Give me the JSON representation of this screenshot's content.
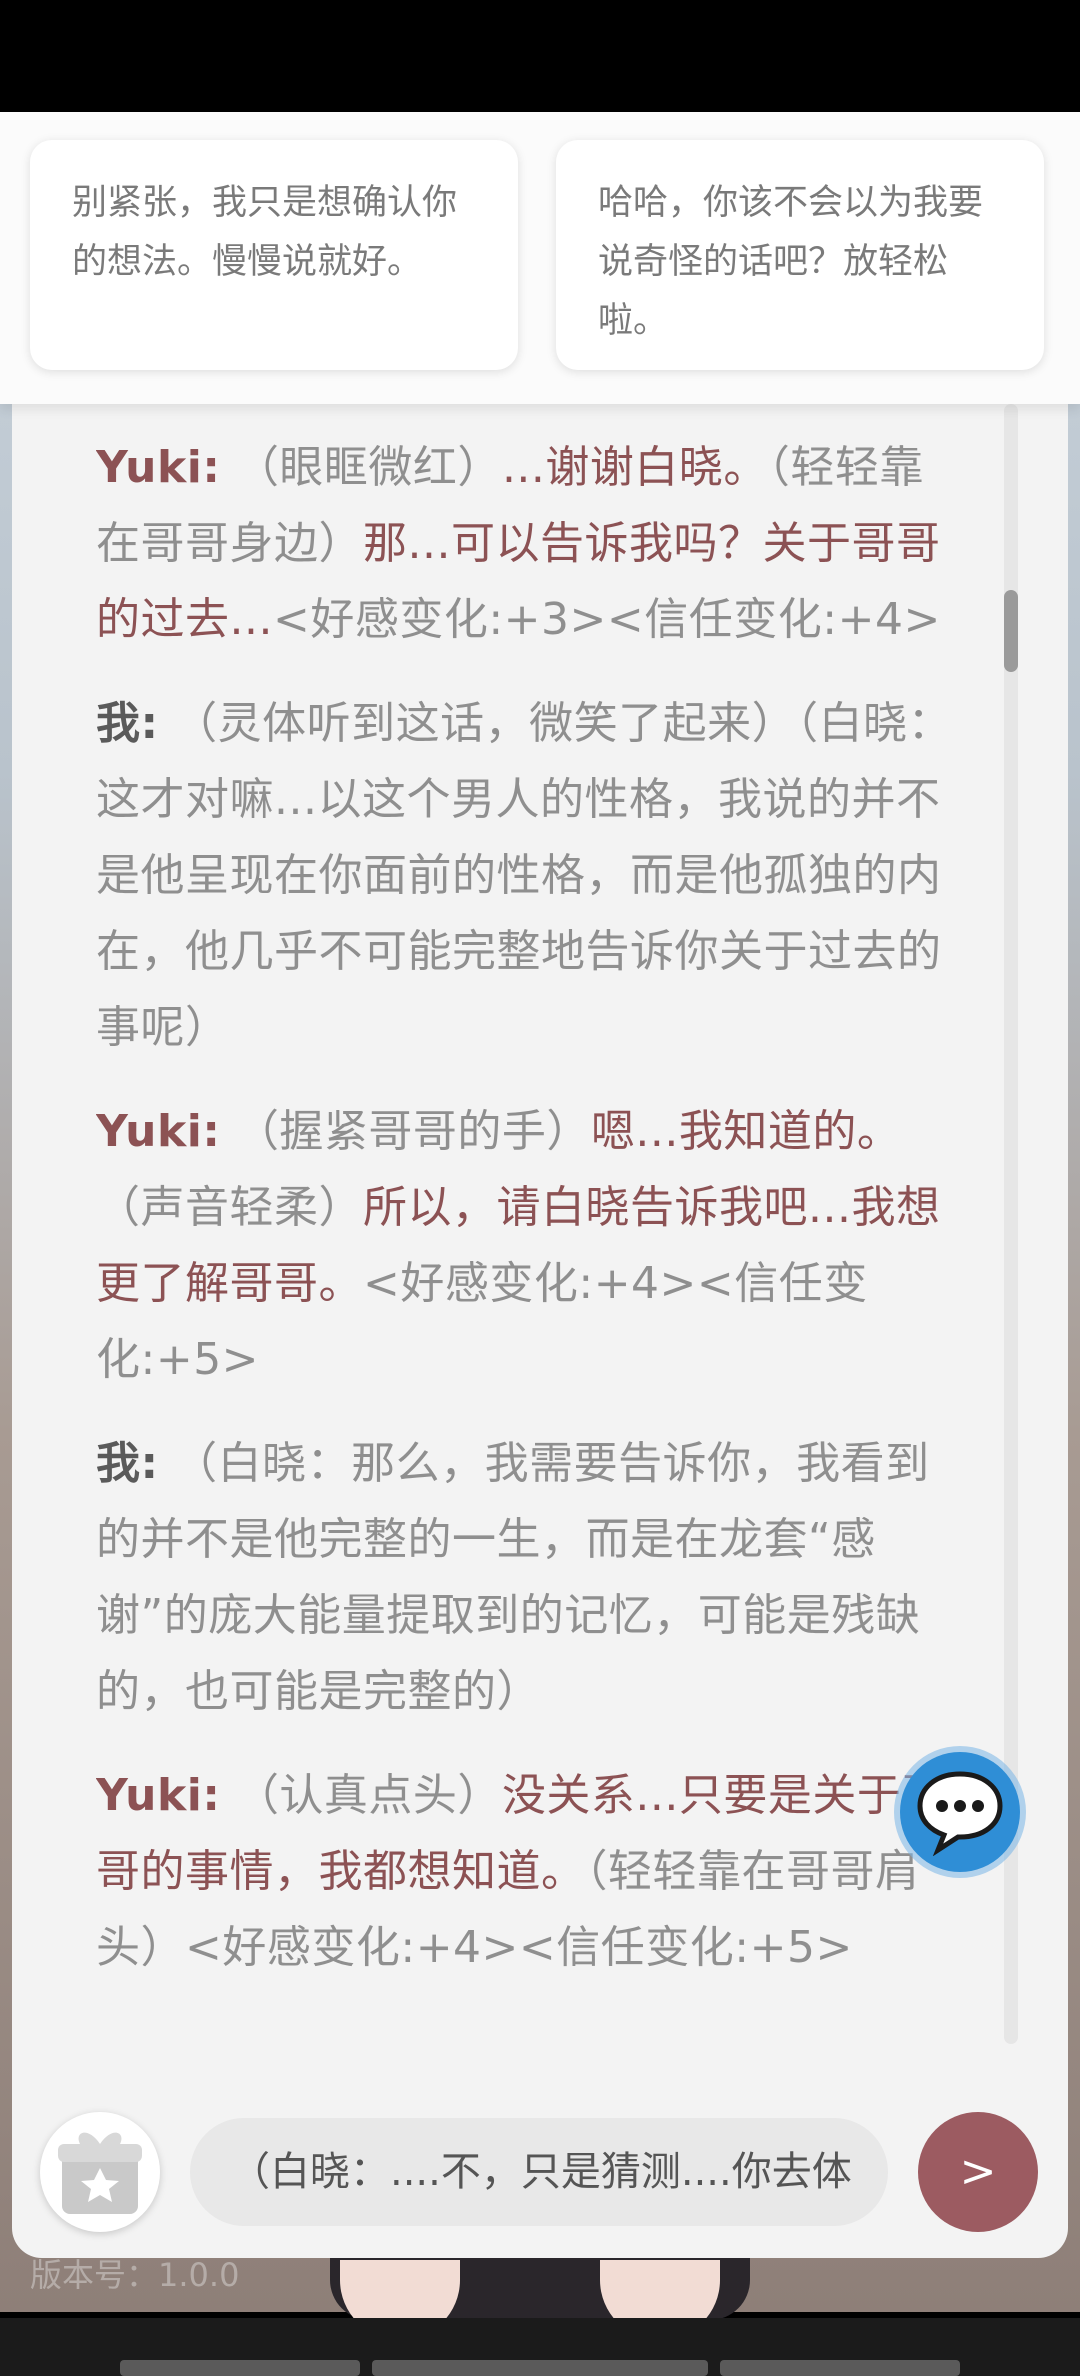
{
  "suggestions": [
    "别紧张，我只是想确认你的想法。慢慢说就好。",
    "哈哈，你该不会以为我要说奇怪的话吧？放轻松啦。"
  ],
  "messages": [
    {
      "speaker": "Yuki:",
      "parts": [
        {
          "t": "（眼眶微红）",
          "s": false
        },
        {
          "t": "...谢谢白晓。",
          "s": true
        },
        {
          "t": "（轻轻靠在哥哥身边）",
          "s": false
        },
        {
          "t": "那...可以告诉我吗？关于哥哥的过去...",
          "s": true
        },
        {
          "t": "<好感变化:+3><信任变化:+4>",
          "s": false
        }
      ]
    },
    {
      "speaker": "我:",
      "parts": [
        {
          "t": "（灵体听到这话，微笑了起来）（白晓：这才对嘛...以这个男人的性格，我说的并不是他呈现在你面前的性格，而是他孤独的内在，他几乎不可能完整地告诉你关于过去的事呢）",
          "s": false
        }
      ]
    },
    {
      "speaker": "Yuki:",
      "parts": [
        {
          "t": "（握紧哥哥的手）",
          "s": false
        },
        {
          "t": "嗯...我知道的。",
          "s": true
        },
        {
          "t": "（声音轻柔）",
          "s": false
        },
        {
          "t": "所以，请白晓告诉我吧...我想更了解哥哥。",
          "s": true
        },
        {
          "t": "<好感变化:+4><信任变化:+5>",
          "s": false
        }
      ]
    },
    {
      "speaker": "我:",
      "parts": [
        {
          "t": "（白晓：那么，我需要告诉你，我看到的并不是他完整的一生，而是在龙套“感谢”的庞大能量提取到的记忆，可能是残缺的，也可能是完整的）",
          "s": false
        }
      ]
    },
    {
      "speaker": "Yuki:",
      "parts": [
        {
          "t": "（认真点头）",
          "s": false
        },
        {
          "t": "没关系...只要是关于哥哥的事情，我都想知道。",
          "s": true
        },
        {
          "t": "（轻轻靠在哥哥肩头）<好感变化:+4><信任变化:+5>",
          "s": false
        }
      ]
    }
  ],
  "input": {
    "value": "（白晓：....不，只是猜测....你去体"
  },
  "send_label": ">",
  "version_label": "版本号：1.0.0",
  "icons": {
    "chat": "chat-bubble-icon",
    "gift": "gift-star-icon"
  },
  "colors": {
    "accent": "#9c5b61",
    "speech": "#8c5254",
    "fab": "#2f8ed6"
  }
}
